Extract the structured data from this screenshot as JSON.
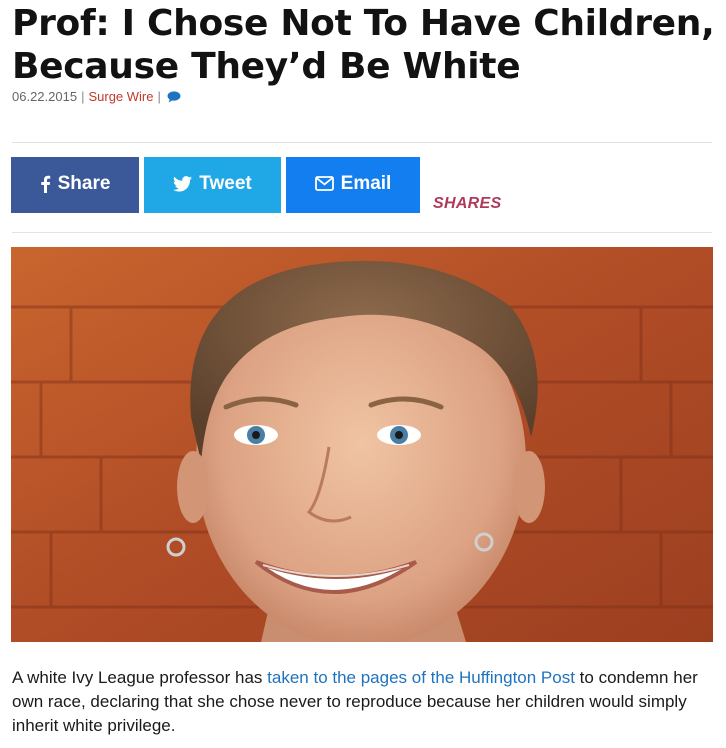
{
  "article": {
    "headline_line1": "Prof: I Chose Not To Have Children,",
    "headline_line2": "Because They’d Be White",
    "date": "06.22.2015",
    "separator": "|",
    "author": "Surge Wire",
    "comment_icon": "comment-bubble-icon"
  },
  "share_bar": {
    "facebook_label": "Share",
    "twitter_label": "Tweet",
    "email_label": "Email",
    "shares_label": "SHARES",
    "colors": {
      "facebook": "#3b5998",
      "twitter": "#20a8e6",
      "email": "#137ef0",
      "shares": "#b03a5b"
    }
  },
  "photo": {
    "alt": "Smiling woman with short hair in front of a red brick wall"
  },
  "body": {
    "intro_before_link": "A white Ivy League professor has ",
    "link_text": "taken to the pages of the Huffington Post",
    "intro_after_link": " to condemn her own race, declaring that she chose never to reproduce because her children would simply inherit white privilege."
  }
}
